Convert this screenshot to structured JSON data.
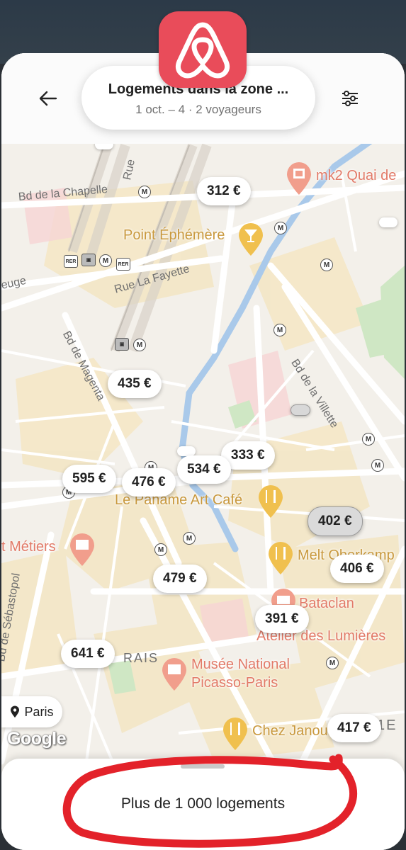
{
  "header": {
    "search_title": "Logements dans la zone ...",
    "search_subtitle": "1 oct. – 4 · 2 voyageurs"
  },
  "brand": {
    "color": "#e94c5a"
  },
  "map": {
    "prices": [
      "312 €",
      "435 €",
      "595 €",
      "476 €",
      "534 €",
      "333 €",
      "402 €",
      "479 €",
      "406 €",
      "391 €",
      "641 €",
      "417 €"
    ],
    "selected_price": "402 €",
    "pois": [
      {
        "name": "mk2 Quai de",
        "icon": "cinema-icon"
      },
      {
        "name": "Point Éphémère",
        "icon": "cocktail-icon"
      },
      {
        "name": "Le Paname Art Café",
        "icon": "restaurant-icon"
      },
      {
        "name": "t Métiers",
        "icon": "museum-icon"
      },
      {
        "name": "Melt Oberkamp",
        "icon": "restaurant-icon"
      },
      {
        "name": "Bataclan",
        "icon": "venue-icon"
      },
      {
        "name": "Atelier des Lumières",
        "icon": "venue-icon"
      },
      {
        "name": "Musée National",
        "icon": "museum-icon"
      },
      {
        "name": "Picasso-Paris",
        "icon": "museum-icon"
      },
      {
        "name": "Chez Janou",
        "icon": "restaurant-icon"
      }
    ],
    "streets": [
      "Bd de la Chapelle",
      "Rue La Fayette",
      "Rue",
      "Bd de Magenta",
      "Bd de la Villette",
      "Bd de Sébastopol",
      "euge",
      "RAIS",
      "1E"
    ],
    "location_chip": "Paris",
    "attribution": "Google"
  },
  "bottom_sheet": {
    "label": "Plus de 1 000 logements"
  }
}
